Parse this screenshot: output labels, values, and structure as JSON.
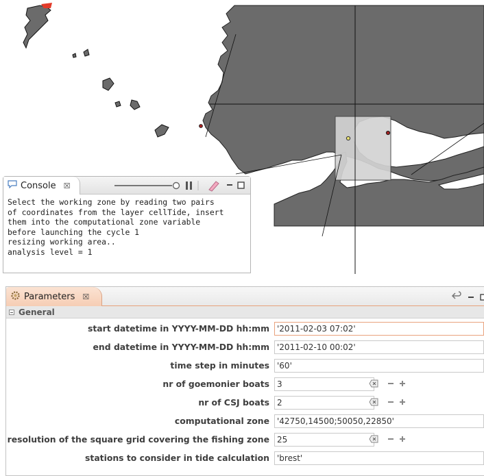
{
  "console": {
    "tab_title": "Console",
    "output": "Select the working zone by reading two pairs\nof coordinates from the layer cellTide, insert\nthem into the computational zone variable\nbefore launching the cycle 1\nresizing working area..\nanalysis level = 1"
  },
  "parameters": {
    "tab_title": "Parameters",
    "section_title": "General",
    "rows": [
      {
        "label": "start datetime in YYYY-MM-DD hh:mm",
        "value": "'2011-02-03 07:02'"
      },
      {
        "label": "end datetime in YYYY-MM-DD hh:mm",
        "value": "'2011-02-10 00:02'"
      },
      {
        "label": "time step in minutes",
        "value": "'60'"
      },
      {
        "label": "nr of goemonier boats",
        "value": "3"
      },
      {
        "label": "nr of CSJ boats",
        "value": "2"
      },
      {
        "label": "computational zone",
        "value": "'42750,14500;50050,22850'"
      },
      {
        "label": "resolution of the square grid covering the fishing zone",
        "value": "25"
      },
      {
        "label": "stations to consider in tide calculation",
        "value": "'brest'"
      }
    ]
  },
  "colors": {
    "land": "#6b6b6b",
    "selection_zone": "#d2d2d2",
    "tab_active": "#f6cdb4",
    "focus_border": "#e9a27d"
  },
  "icons": {
    "console_tab": "console-icon",
    "parameters_tab": "gear-icon",
    "clear": "clear-icon",
    "minus": "minus-icon",
    "plus": "plus-icon"
  }
}
